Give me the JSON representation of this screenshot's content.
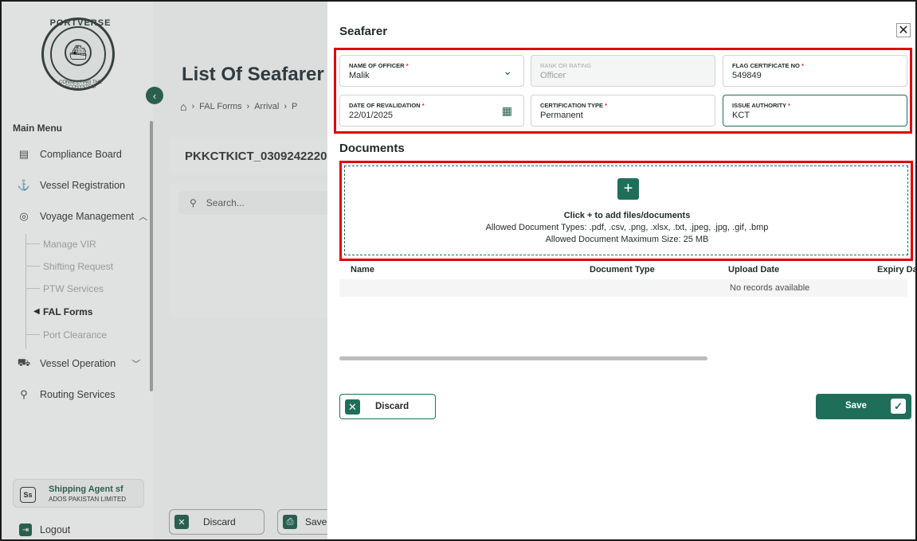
{
  "sidebar": {
    "logo_top": "PORTVERSE",
    "logo_bottom": "CONNECTING THE ECOSYSTEM",
    "main_menu_label": "Main Menu",
    "items": [
      {
        "label": "Compliance Board",
        "icon": "board-icon"
      },
      {
        "label": "Vessel Registration",
        "icon": "ship-icon"
      },
      {
        "label": "Voyage Management",
        "icon": "compass-icon"
      },
      {
        "label": "Vessel Operation",
        "icon": "vessel-icon"
      },
      {
        "label": "Routing Services",
        "icon": "route-icon"
      }
    ],
    "voyage_subitems": [
      "Manage VIR",
      "Shifting Request",
      "PTW Services",
      "FAL Forms",
      "Port Clearance"
    ],
    "agent": {
      "initials": "Ss",
      "name": "Shipping Agent sf",
      "company": "ADOS PAKISTAN LIMITED"
    },
    "logout_label": "Logout"
  },
  "background": {
    "page_title": "List Of Seafarer",
    "breadcrumb": [
      "FAL Forms",
      "Arrival",
      "P"
    ],
    "reference_id": "PKKCTKICT_0309242220",
    "search_placeholder": "Search...",
    "discard_label": "Discard",
    "save_label": "Save"
  },
  "drawer": {
    "title": "Seafarer",
    "close_icon": "close-icon",
    "fields": {
      "name_of_officer": {
        "label": "NAME OF OFFICER",
        "required": "*",
        "value": "Malik"
      },
      "rank_or_rating": {
        "label": "RANK OR RATING",
        "value": "Officer"
      },
      "flag_certificate_no": {
        "label": "FLAG CERTIFICATE NO",
        "required": "*",
        "value": "549849"
      },
      "date_of_revalidation": {
        "label": "DATE OF REVALIDATION",
        "required": "*",
        "value": "22/01/2025"
      },
      "certification_type": {
        "label": "CERTIFICATION TYPE",
        "required": "*",
        "value": "Permanent"
      },
      "issue_authority": {
        "label": "ISSUE AUTHORITY",
        "required": "*",
        "value": "KCT"
      }
    },
    "documents": {
      "title": "Documents",
      "add_hint": "Click + to add files/documents",
      "allowed_types": "Allowed Document Types: .pdf, .csv, .png, .xlsx, .txt, .jpeg, .jpg, .gif, .bmp",
      "max_size": "Allowed Document Maximum Size: 25 MB",
      "columns": [
        "Name",
        "Document Type",
        "Upload Date",
        "Expiry Da"
      ],
      "empty_text": "No records available"
    },
    "discard_label": "Discard",
    "save_label": "Save"
  },
  "colors": {
    "accent": "#1f6e5a",
    "highlight": "#e00000"
  }
}
